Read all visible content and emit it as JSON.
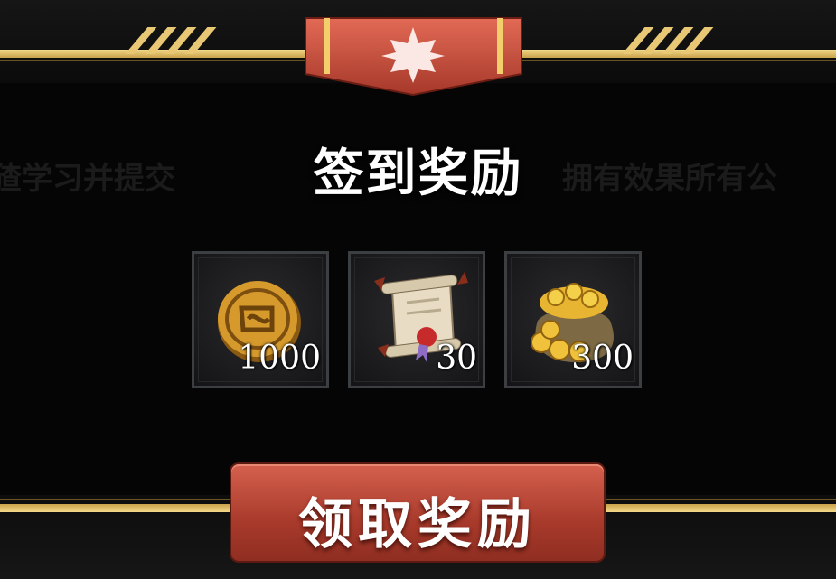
{
  "background_text": {
    "left": "猹学习并提交",
    "right": "拥有效果所有公"
  },
  "dialog": {
    "title": "签到奖励",
    "emblem_icon": "cross-emblem-icon"
  },
  "rewards": [
    {
      "icon": "gold-coin-icon",
      "count": "1000"
    },
    {
      "icon": "scroll-icon",
      "count": "30"
    },
    {
      "icon": "coin-bag-icon",
      "count": "300"
    }
  ],
  "claim_button": {
    "label": "领取奖励"
  },
  "colors": {
    "gold": "#e8c874",
    "red": "#c14b3a",
    "panel": "#050505"
  }
}
